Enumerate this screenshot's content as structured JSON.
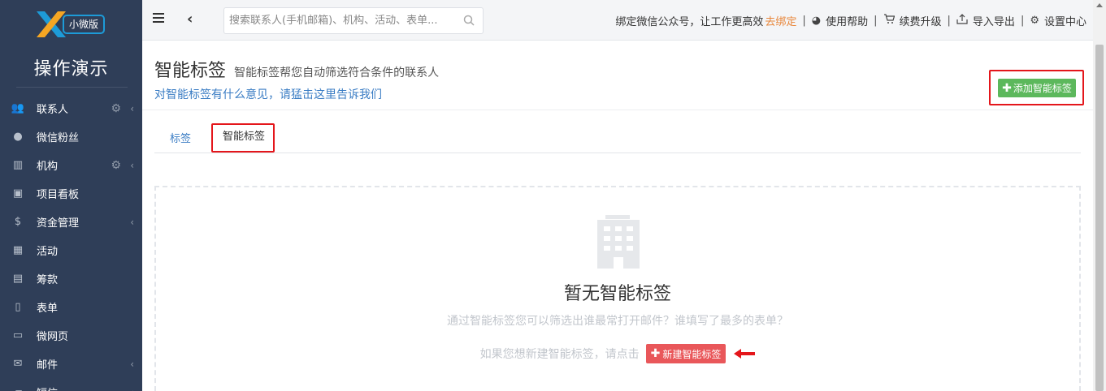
{
  "sidebar": {
    "logo_badge": "小微版",
    "app_title": "操作演示",
    "items": [
      {
        "label": "联系人",
        "icon": "users-icon",
        "gear": true,
        "chevron": true
      },
      {
        "label": "微信粉丝",
        "icon": "chat-bubble-icon",
        "gear": false,
        "chevron": false
      },
      {
        "label": "机构",
        "icon": "building-icon",
        "gear": true,
        "chevron": true
      },
      {
        "label": "项目看板",
        "icon": "inbox-icon",
        "gear": false,
        "chevron": false
      },
      {
        "label": "资金管理",
        "icon": "dollar-icon",
        "gear": false,
        "chevron": true
      },
      {
        "label": "活动",
        "icon": "calendar-icon",
        "gear": false,
        "chevron": false
      },
      {
        "label": "筹款",
        "icon": "money-icon",
        "gear": false,
        "chevron": false
      },
      {
        "label": "表单",
        "icon": "clipboard-icon",
        "gear": false,
        "chevron": false
      },
      {
        "label": "微网页",
        "icon": "file-icon",
        "gear": false,
        "chevron": false
      },
      {
        "label": "邮件",
        "icon": "envelope-icon",
        "gear": false,
        "chevron": true
      },
      {
        "label": "短信",
        "icon": "sms-icon",
        "gear": false,
        "chevron": true
      }
    ]
  },
  "topbar": {
    "search_placeholder": "搜索联系人(手机邮箱)、机构、活动、表单...",
    "bind_text": "绑定微信公众号，让工作更高效",
    "bind_link": "去绑定",
    "help": "使用帮助",
    "upgrade": "续费升级",
    "import_export": "导入导出",
    "settings": "设置中心"
  },
  "page": {
    "title": "智能标签",
    "subtitle": "智能标签帮您自动筛选符合条件的联系人",
    "feedback": "对智能标签有什么意见，请猛击这里告诉我们",
    "add_button": "添加智能标签",
    "tabs": [
      "标签",
      "智能标签"
    ],
    "empty_title": "暂无智能标签",
    "empty_desc": "通过智能标签您可以筛选出谁最常打开邮件？谁填写了最多的表单？",
    "cta_text": "如果您想新建智能标签，请点击",
    "new_button": "新建智能标签"
  },
  "colors": {
    "sidebar_bg": "#2f3e58",
    "accent_green": "#5cb85c",
    "accent_red_btn": "#e9575a",
    "highlight_red": "#e4161b",
    "link_blue": "#3b7dc4",
    "link_orange": "#e8863a"
  }
}
